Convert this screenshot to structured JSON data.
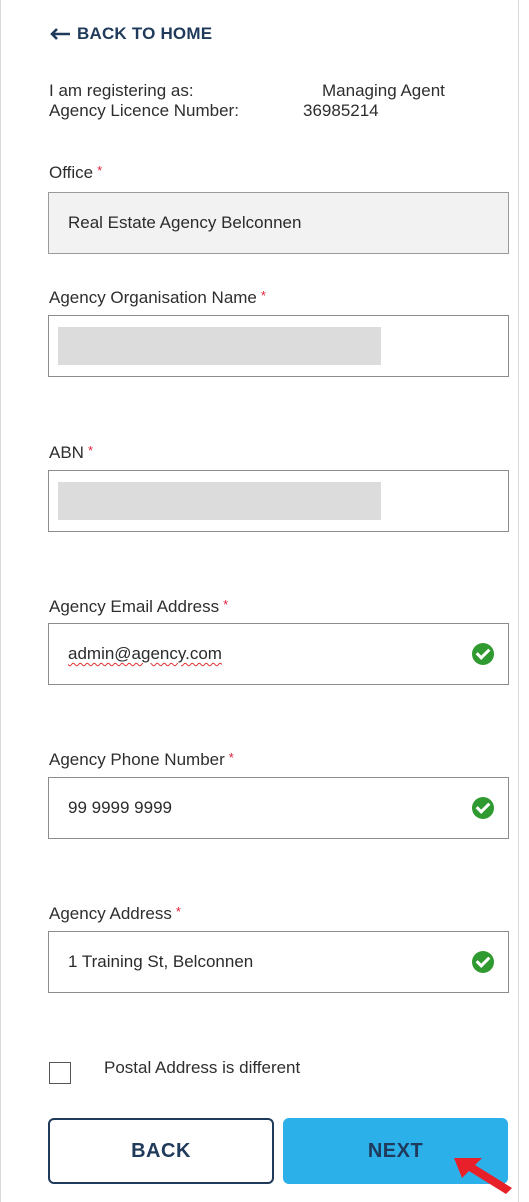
{
  "nav": {
    "back_to_home": "BACK TO HOME"
  },
  "registration": {
    "registering_as_label": "I am registering as:",
    "registering_as_value": "Managing Agent",
    "licence_label": "Agency Licence Number:",
    "licence_value": "36985214"
  },
  "form": {
    "required_mark": "*",
    "office": {
      "label": "Office",
      "value": "Real Estate Agency Belconnen"
    },
    "organisation_name": {
      "label": "Agency Organisation Name",
      "value": ""
    },
    "abn": {
      "label": "ABN",
      "value": ""
    },
    "email": {
      "label": "Agency Email Address",
      "value": "admin@agency.com"
    },
    "phone": {
      "label": "Agency Phone Number",
      "value": "99 9999 9999"
    },
    "address": {
      "label": "Agency Address",
      "value": "1 Training St, Belconnen"
    },
    "postal_checkbox": {
      "label": "Postal Address is different",
      "checked": false
    }
  },
  "buttons": {
    "back": "BACK",
    "next": "NEXT"
  },
  "colors": {
    "navy": "#1f3a5a",
    "next_button": "#2bb0ea",
    "valid_green": "#2f9a2f",
    "required_red": "#e0203a",
    "annotation_arrow": "#e8202a"
  },
  "icons": {
    "back_arrow": "arrow-left-icon",
    "valid": "check-circle-icon",
    "pointer": "red-arrow-annotation"
  }
}
